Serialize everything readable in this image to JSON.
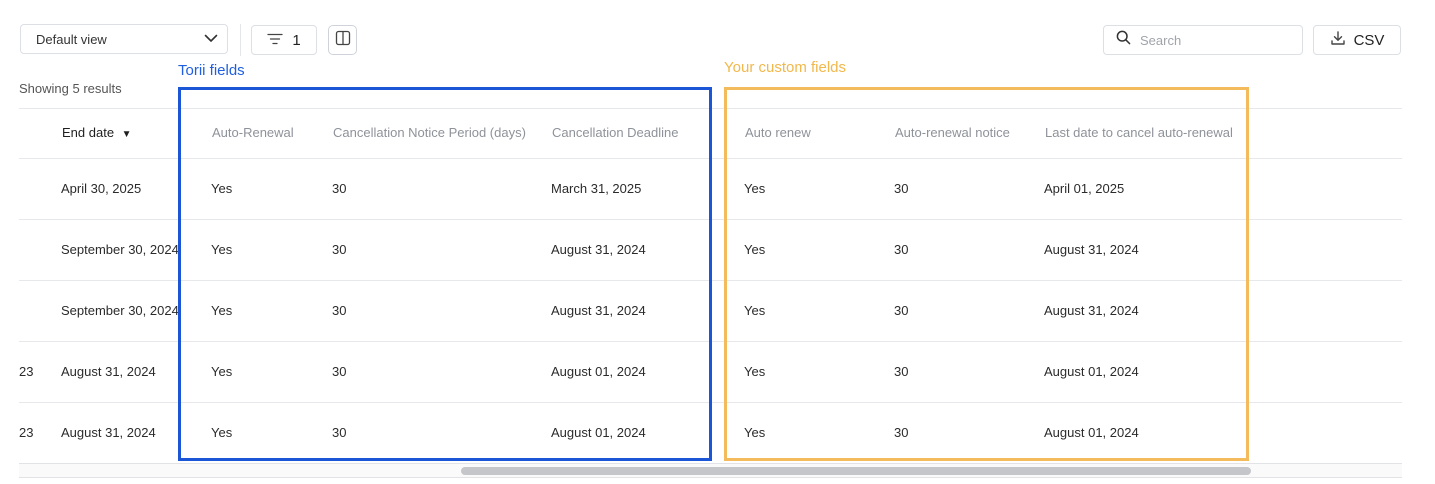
{
  "toolbar": {
    "view_select": "Default view",
    "filter_count": "1",
    "search_placeholder": "Search",
    "csv_label": "CSV"
  },
  "results_text": "Showing 5 results",
  "annotations": {
    "torii_label": "Torii fields",
    "custom_label": "Your custom fields",
    "torii_color": "#1a56d6",
    "custom_color": "#f3bb5b"
  },
  "table": {
    "columns": [
      "End date",
      "Auto-Renewal",
      "Cancellation Notice Period (days)",
      "Cancellation Deadline",
      "Auto renew",
      "Auto-renewal notice",
      "Last date to cancel auto-renewal"
    ],
    "sort_indicator": "▼",
    "rows": [
      {
        "prev": "",
        "cells": [
          "April 30, 2025",
          "Yes",
          "30",
          "March 31, 2025",
          "Yes",
          "30",
          "April 01, 2025"
        ]
      },
      {
        "prev": "",
        "cells": [
          "September 30, 2024",
          "Yes",
          "30",
          "August 31, 2024",
          "Yes",
          "30",
          "August 31, 2024"
        ]
      },
      {
        "prev": "",
        "cells": [
          "September 30, 2024",
          "Yes",
          "30",
          "August 31, 2024",
          "Yes",
          "30",
          "August 31, 2024"
        ]
      },
      {
        "prev": "23",
        "cells": [
          "August 31, 2024",
          "Yes",
          "30",
          "August 01, 2024",
          "Yes",
          "30",
          "August 01, 2024"
        ]
      },
      {
        "prev": "23",
        "cells": [
          "August 31, 2024",
          "Yes",
          "30",
          "August 01, 2024",
          "Yes",
          "30",
          "August 01, 2024"
        ]
      }
    ]
  }
}
